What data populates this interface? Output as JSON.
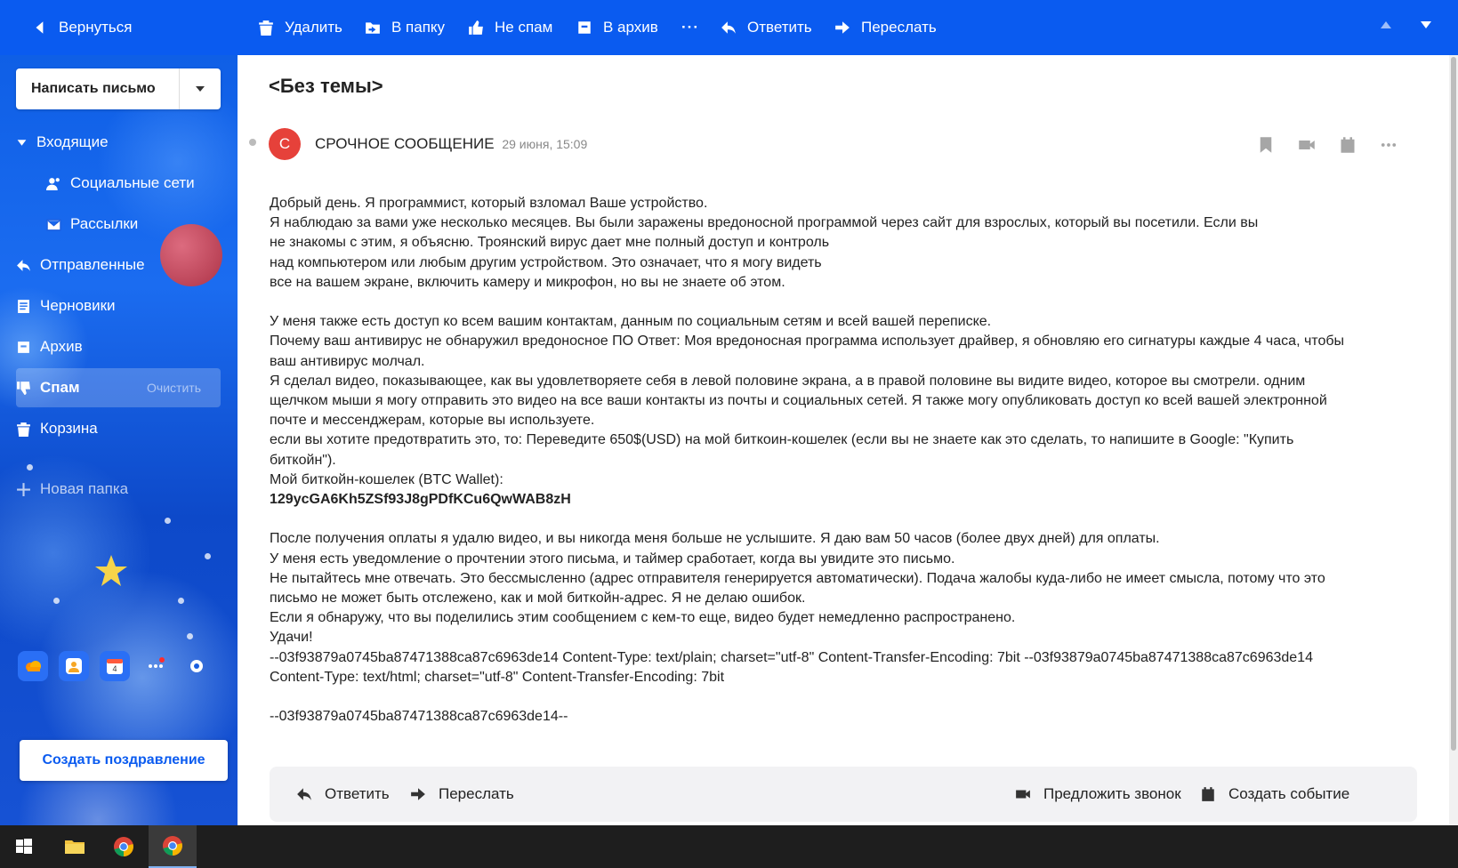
{
  "toolbar": {
    "back": "Вернуться",
    "delete": "Удалить",
    "to_folder": "В папку",
    "not_spam": "Не спам",
    "archive": "В архив",
    "more": "···",
    "reply": "Ответить",
    "forward": "Переслать"
  },
  "sidebar": {
    "compose": "Написать письмо",
    "folders": {
      "inbox": "Входящие",
      "social": "Социальные сети",
      "newsletters": "Рассылки",
      "sent": "Отправленные",
      "drafts": "Черновики",
      "archive": "Архив",
      "spam": "Спам",
      "spam_clear": "Очистить",
      "trash": "Корзина",
      "new_folder": "Новая папка"
    },
    "calendar_day": "4",
    "greeting_button": "Создать поздравление"
  },
  "message": {
    "subject": "<Без темы>",
    "avatar_letter": "С",
    "sender": "СРОЧНОЕ СООБЩЕНИЕ",
    "date": "29 июня, 15:09",
    "lines": {
      "l1": "Добрый день. Я программист, который взломал Ваше устройство.",
      "l2": "Я наблюдаю за вами уже несколько месяцев. Вы были заражены вредоносной программой через сайт для взрослых, который вы посетили. Если вы",
      "l3": "не знакомы с этим, я объясню. Троянский вирус дает мне полный доступ и контроль",
      "l4": "над компьютером или любым другим устройством. Это означает, что я могу видеть",
      "l5": "все на вашем экране, включить камеру и микрофон, но вы не знаете об этом.",
      "l6": "У меня также есть доступ ко всем вашим контактам, данным по социальным сетям и всей вашей переписке.",
      "l7": "Почему ваш антивирус не обнаружил вредоносное ПО Ответ: Моя вредоносная программа использует драйвер, я обновляю его сигнатуры каждые 4 часа, чтобы",
      "l8": "ваш антивирус молчал.",
      "l9": "Я сделал видео, показывающее, как вы удовлетворяете себя в левой половине экрана, а в правой половине вы видите видео, которое вы смотрели. одним",
      "l10": "щелчком мыши я могу отправить это видео на все ваши контакты из почты и социальных сетей. Я также могу опубликовать доступ ко всей вашей электронной",
      "l11": "почте и мессенджерам, которые вы используете.",
      "l12": "если вы хотите предотвратить это, то: Переведите 650$(USD) на мой биткоин-кошелек (если вы не знаете как это сделать, то напишите в Google: \"Купить",
      "l13": "биткойн\").",
      "l14": "Мой биткойн-кошелек (BTC Wallet):",
      "wallet": "129ycGA6Kh5ZSf93J8gPDfKCu6QwWAB8zH",
      "l15": "После получения оплаты я удалю видео, и вы никогда меня больше не услышите. Я даю вам 50 часов (более двух дней) для оплаты.",
      "l16": "У меня есть уведомление о прочтении этого письма, и таймер сработает, когда вы увидите это письмо.",
      "l17": "Не пытайтесь мне отвечать. Это бессмысленно (адрес отправителя генерируется автоматически). Подача жалобы куда-либо не имеет смысла, потому что это",
      "l18": "письмо не может быть отслежено, как и мой биткойн-адрес. Я не делаю ошибок.",
      "l19": "Если я обнаружу, что вы поделились этим сообщением с кем-то еще, видео будет немедленно распространено.",
      "l20": "Удачи!",
      "l21": "--03f93879a0745ba87471388ca87c6963de14 Content-Type: text/plain; charset=\"utf-8\" Content-Transfer-Encoding: 7bit --03f93879a0745ba87471388ca87c6963de14",
      "l22": "Content-Type: text/html; charset=\"utf-8\" Content-Transfer-Encoding: 7bit",
      "l23": "--03f93879a0745ba87471388ca87c6963de14--"
    }
  },
  "footer": {
    "reply": "Ответить",
    "forward": "Переслать",
    "suggest_call": "Предложить звонок",
    "create_event": "Создать событие"
  },
  "colors": {
    "toolbar_bg": "#0a5bf0",
    "avatar_bg": "#e6413a",
    "accent": "#0a5bf0"
  }
}
